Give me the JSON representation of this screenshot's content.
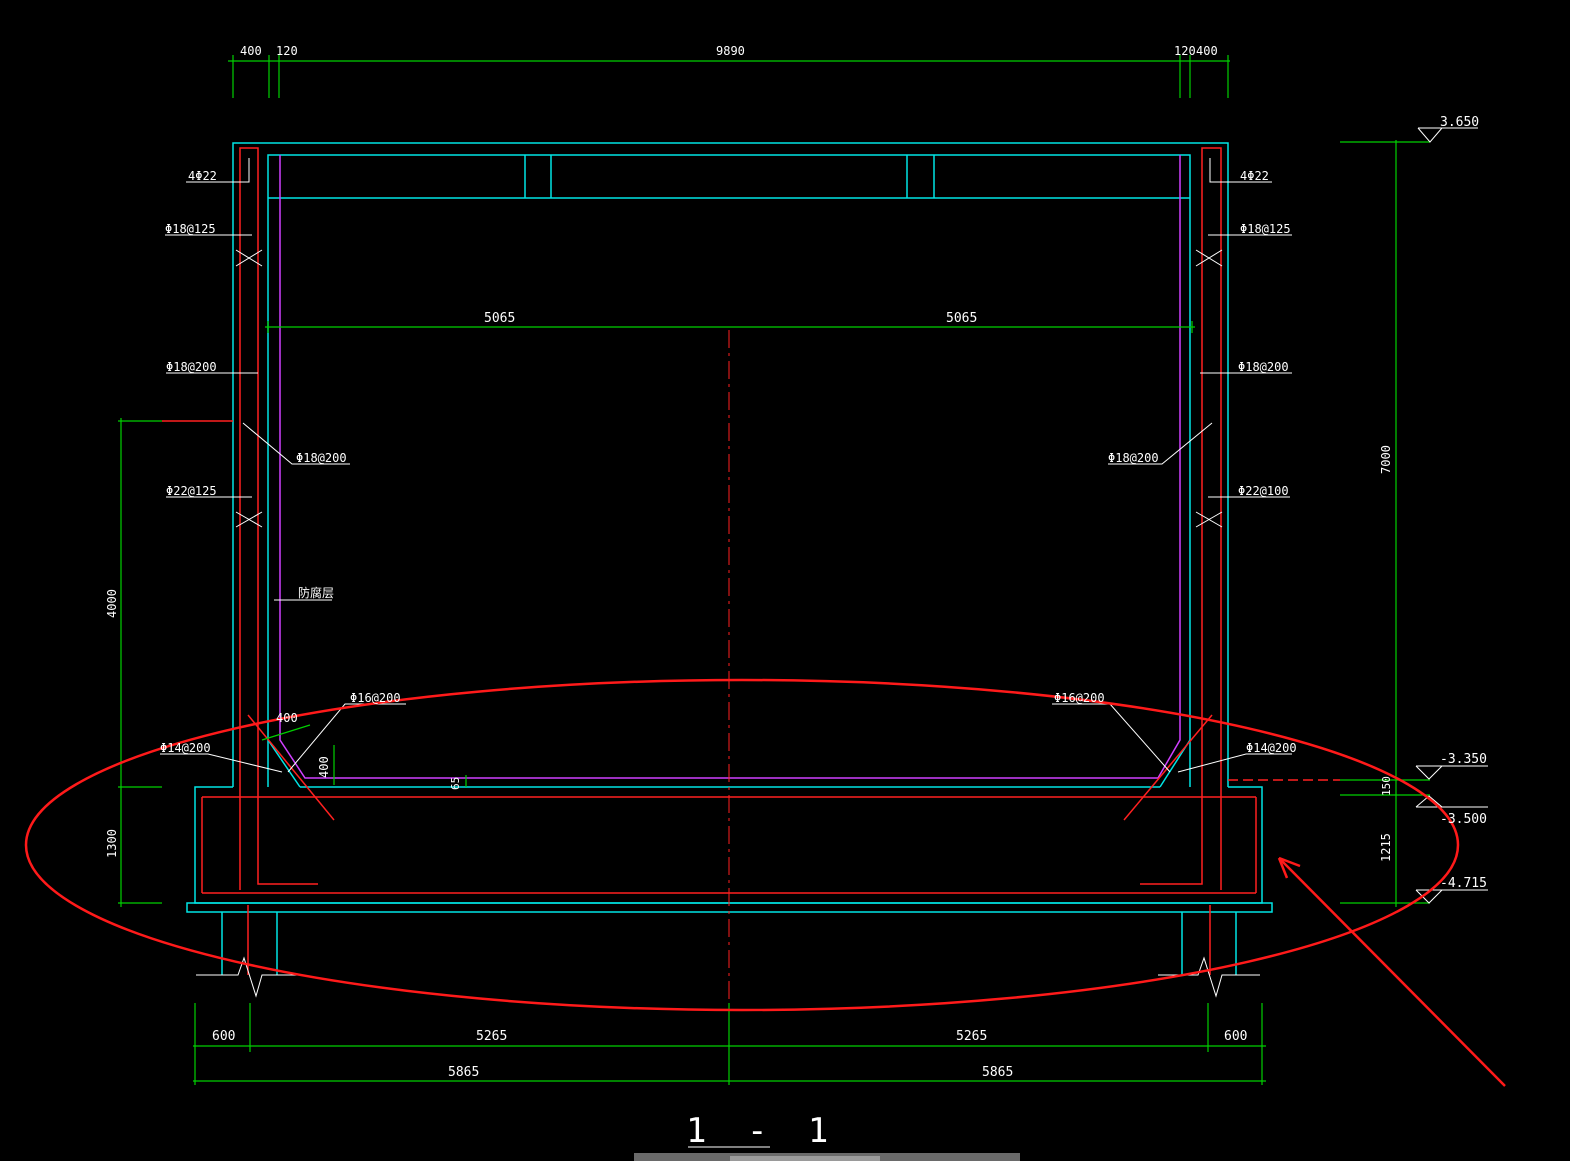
{
  "drawing": {
    "section_title": "1 - 1",
    "top_dims": [
      "400",
      "120",
      "9890",
      "120",
      "400"
    ],
    "mid_dims": [
      "5065",
      "5065"
    ],
    "bottom_dims_row1": [
      "600",
      "5265",
      "5265",
      "600"
    ],
    "bottom_dims_row2": [
      "5865",
      "5865"
    ],
    "left_vertical_dims": [
      "4000",
      "1300"
    ],
    "right_vertical_dims": [
      "7000",
      "150",
      "1215"
    ],
    "elevations": [
      "3.650",
      "-3.350",
      "-3.500",
      "-4.715"
    ],
    "rebar_left": [
      "4Φ22",
      "Φ18@125",
      "Φ18@200",
      "Φ18@200",
      "Φ22@125",
      "Φ16@200",
      "Φ14@200"
    ],
    "rebar_right": [
      "4Φ22",
      "Φ18@125",
      "Φ18@200",
      "Φ18@200",
      "Φ22@100",
      "Φ16@200",
      "Φ14@200"
    ],
    "haunch_dims": [
      "400",
      "400"
    ],
    "small_dim": "65",
    "layer_note": "防腐层"
  },
  "colors": {
    "concrete_outline": "#00e5e5",
    "rebar": "#ff2020",
    "dimension": "#00d000",
    "lining": "#d040ff",
    "annotation": "#ff1a1a"
  }
}
